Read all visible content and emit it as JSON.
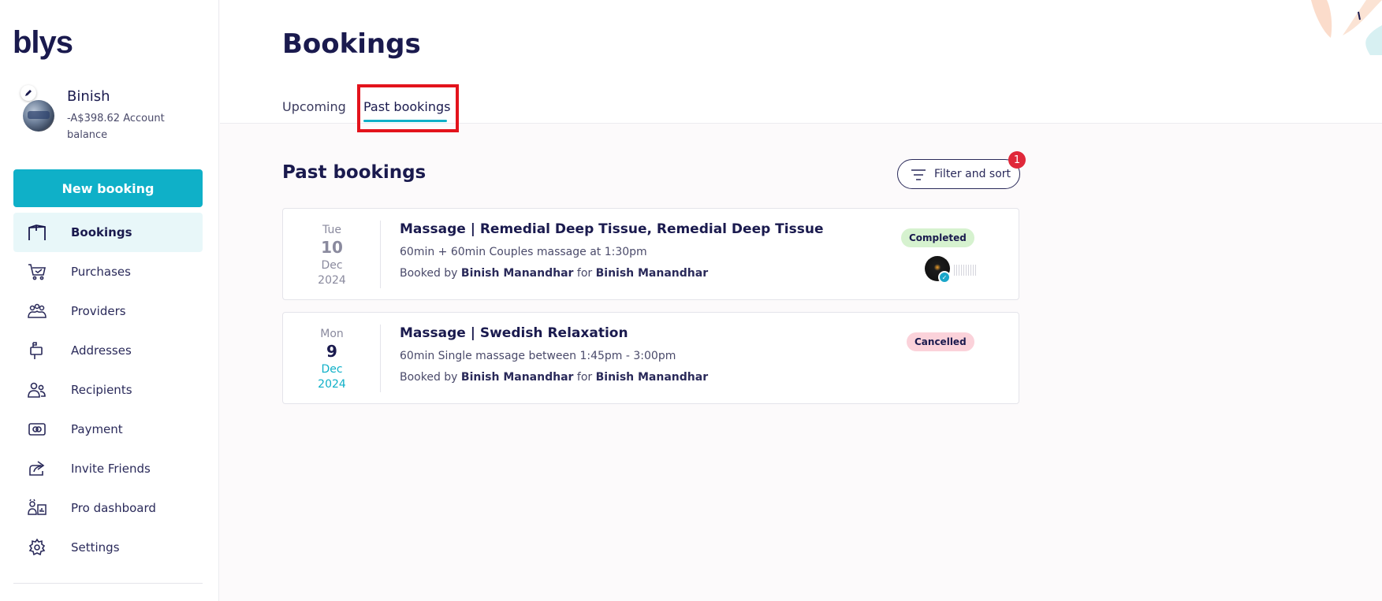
{
  "sidebar": {
    "logo": "blys",
    "profile": {
      "name": "Binish",
      "balance": "-A$398.62 Account balance"
    },
    "new_booking_label": "New booking",
    "nav": [
      {
        "label": "Bookings",
        "icon": "bookings-icon",
        "active": true
      },
      {
        "label": "Purchases",
        "icon": "cart-icon"
      },
      {
        "label": "Providers",
        "icon": "providers-icon"
      },
      {
        "label": "Addresses",
        "icon": "mailbox-icon"
      },
      {
        "label": "Recipients",
        "icon": "recipients-icon"
      },
      {
        "label": "Payment",
        "icon": "payment-icon"
      },
      {
        "label": "Invite Friends",
        "icon": "share-icon"
      },
      {
        "label": "Pro dashboard",
        "icon": "pro-dashboard-icon"
      },
      {
        "label": "Settings",
        "icon": "gear-icon"
      }
    ]
  },
  "header": {
    "title": "Bookings",
    "tabs": [
      {
        "label": "Upcoming"
      },
      {
        "label": "Past bookings",
        "active": true
      }
    ]
  },
  "main": {
    "section_title": "Past bookings",
    "filter": {
      "label": "Filter and sort",
      "count": "1"
    },
    "bookings": [
      {
        "dow": "Tue",
        "day": "10",
        "month": "Dec",
        "year": "2024",
        "title": "Massage | Remedial Deep Tissue, Remedial Deep Tissue",
        "detail": "60min + 60min Couples massage at 1:30pm",
        "booked_by_prefix": "Booked by",
        "booked_by": "Binish Manandhar",
        "for_word": "for",
        "recipient": "Binish Manandhar",
        "status": "Completed"
      },
      {
        "dow": "Mon",
        "day": "9",
        "month": "Dec",
        "year": "2024",
        "title": "Massage | Swedish Relaxation",
        "detail": "60min Single massage between 1:45pm - 3:00pm",
        "booked_by_prefix": "Booked by",
        "booked_by": "Binish Manandhar",
        "for_word": "for",
        "recipient": "Binish Manandhar",
        "status": "Cancelled"
      }
    ]
  },
  "colors": {
    "brand": "#0fb0c8",
    "navy": "#1a1a4e",
    "completed_bg": "#d6f2cf",
    "cancelled_bg": "#fbd2da",
    "badge_red": "#e0283a",
    "highlight_red": "#e3131c"
  }
}
